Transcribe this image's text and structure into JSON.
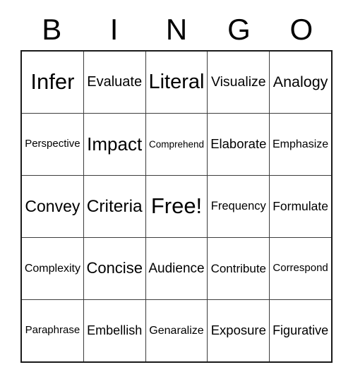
{
  "header": {
    "letters": [
      "B",
      "I",
      "N",
      "G",
      "O"
    ]
  },
  "colors": {
    "background": "#ffffff",
    "text": "#000000",
    "grid_line": "#3d3d3d",
    "grid_border": "#1a1a1a"
  },
  "grid": {
    "rows": 5,
    "columns": 5,
    "free_space": {
      "row": 2,
      "column": 2,
      "label": "Free!"
    },
    "cells": [
      [
        {
          "label": "Infer"
        },
        {
          "label": "Evaluate"
        },
        {
          "label": "Literal"
        },
        {
          "label": "Visualize"
        },
        {
          "label": "Analogy"
        }
      ],
      [
        {
          "label": "Perspective"
        },
        {
          "label": "Impact"
        },
        {
          "label": "Comprehend"
        },
        {
          "label": "Elaborate"
        },
        {
          "label": "Emphasize"
        }
      ],
      [
        {
          "label": "Convey"
        },
        {
          "label": "Criteria"
        },
        {
          "label": "Free!"
        },
        {
          "label": "Frequency"
        },
        {
          "label": "Formulate"
        }
      ],
      [
        {
          "label": "Complexity"
        },
        {
          "label": "Concise"
        },
        {
          "label": "Audience"
        },
        {
          "label": "Contribute"
        },
        {
          "label": "Correspond"
        }
      ],
      [
        {
          "label": "Paraphrase"
        },
        {
          "label": "Embellish"
        },
        {
          "label": "Genaralize"
        },
        {
          "label": "Exposure"
        },
        {
          "label": "Figurative"
        }
      ]
    ]
  }
}
